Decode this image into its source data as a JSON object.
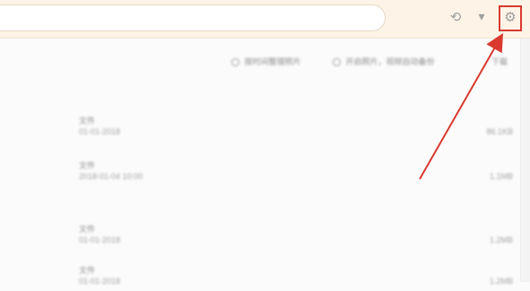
{
  "header": {
    "search": {
      "value": "",
      "placeholder": ""
    },
    "icons": {
      "sync": "sync-icon",
      "filter": "filter-icon",
      "settings": "gear-icon"
    }
  },
  "toolbar": {
    "items": [
      {
        "label": "按时间整理照片",
        "icon": "calendar-icon"
      },
      {
        "label": "开启照片，视频自动备份",
        "icon": "backup-icon"
      },
      {
        "label": "下载",
        "icon": "download-icon"
      }
    ]
  },
  "list": [
    {
      "title": "文件",
      "subtitle": "01-01-2018",
      "value": "86.1KB"
    },
    {
      "title": "文件",
      "subtitle": "2018-01-04 10:00",
      "value": "1.1MB"
    },
    {
      "title": "文件",
      "subtitle": "01-01-2018",
      "value": "1.2MB"
    },
    {
      "title": "文件",
      "subtitle": "01-01-2018",
      "value": "1.2MB"
    }
  ],
  "annotation": {
    "color": "#d9392f"
  }
}
